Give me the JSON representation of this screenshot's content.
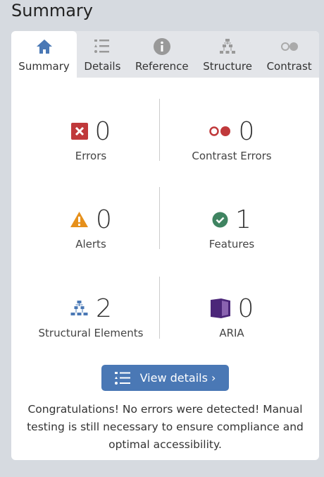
{
  "title": "Summary",
  "tabs": [
    {
      "label": "Summary",
      "icon": "home-icon"
    },
    {
      "label": "Details",
      "icon": "list-icon"
    },
    {
      "label": "Reference",
      "icon": "info-icon"
    },
    {
      "label": "Structure",
      "icon": "structure-icon"
    },
    {
      "label": "Contrast",
      "icon": "contrast-icon"
    }
  ],
  "stats": [
    {
      "label": "Errors",
      "count": "0",
      "icon": "error-icon",
      "color": "#c0393b"
    },
    {
      "label": "Contrast Errors",
      "count": "0",
      "icon": "contrast-error-icon",
      "color": "#c0393b"
    },
    {
      "label": "Alerts",
      "count": "0",
      "icon": "alert-icon",
      "color": "#e6901b"
    },
    {
      "label": "Features",
      "count": "1",
      "icon": "feature-icon",
      "color": "#3f8461"
    },
    {
      "label": "Structural Elements",
      "count": "2",
      "icon": "structure-icon",
      "color": "#4a78b5"
    },
    {
      "label": "ARIA",
      "count": "0",
      "icon": "aria-icon",
      "color": "#4b2679"
    }
  ],
  "button": {
    "label": "View details ›"
  },
  "message": "Congratulations! No errors were detected! Manual testing is still necessary to ensure compliance and optimal accessibility."
}
